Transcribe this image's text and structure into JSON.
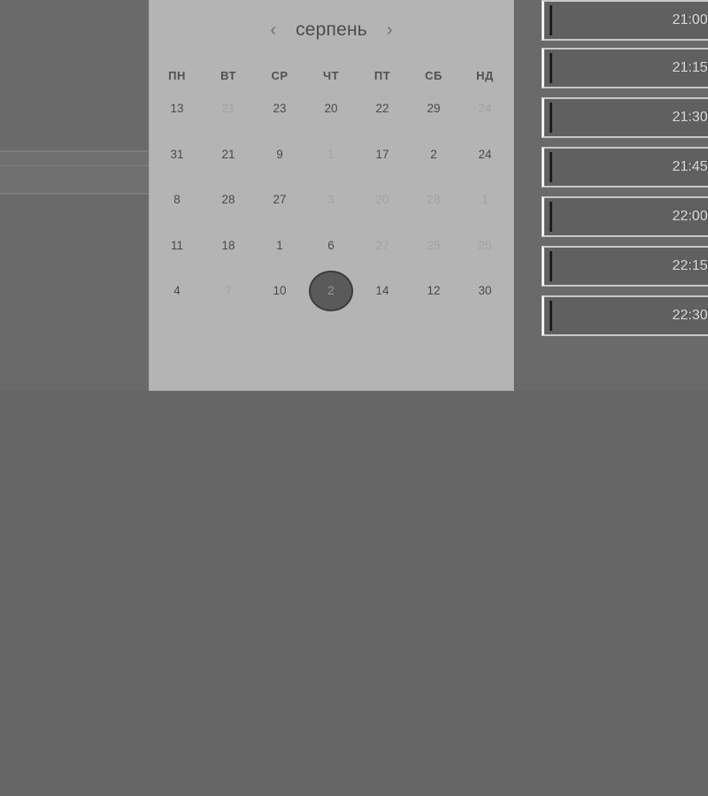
{
  "calendar": {
    "month": "серпень",
    "prev_icon": "‹",
    "next_icon": "›",
    "weekdays": [
      "ПН",
      "ВТ",
      "СР",
      "ЧТ",
      "ПТ",
      "СБ",
      "НД"
    ],
    "rows": [
      [
        {
          "d": "13"
        },
        {
          "d": "21",
          "muted": true
        },
        {
          "d": "23"
        },
        {
          "d": "20"
        },
        {
          "d": "22"
        },
        {
          "d": "29"
        },
        {
          "d": "24",
          "muted": true
        }
      ],
      [
        {
          "d": "31"
        },
        {
          "d": "21"
        },
        {
          "d": "9"
        },
        {
          "d": "1",
          "muted": true
        },
        {
          "d": "17"
        },
        {
          "d": "2"
        },
        {
          "d": "24"
        }
      ],
      [
        {
          "d": "8"
        },
        {
          "d": "28"
        },
        {
          "d": "27"
        },
        {
          "d": "3",
          "muted": true
        },
        {
          "d": "20",
          "muted": true
        },
        {
          "d": "28",
          "muted": true
        },
        {
          "d": "1",
          "muted": true
        }
      ],
      [
        {
          "d": "11"
        },
        {
          "d": "18"
        },
        {
          "d": "1"
        },
        {
          "d": "6"
        },
        {
          "d": "27",
          "muted": true
        },
        {
          "d": "25",
          "muted": true
        },
        {
          "d": "25",
          "muted": true
        }
      ],
      [
        {
          "d": "4"
        },
        {
          "d": "7",
          "muted": true
        },
        {
          "d": "10"
        },
        {
          "d": "2",
          "selected": true
        },
        {
          "d": "14"
        },
        {
          "d": "12"
        },
        {
          "d": "30"
        }
      ]
    ]
  },
  "time_slots": [
    "21:00",
    "21:15",
    "21:30",
    "21:45",
    "22:00",
    "22:15",
    "22:30"
  ]
}
